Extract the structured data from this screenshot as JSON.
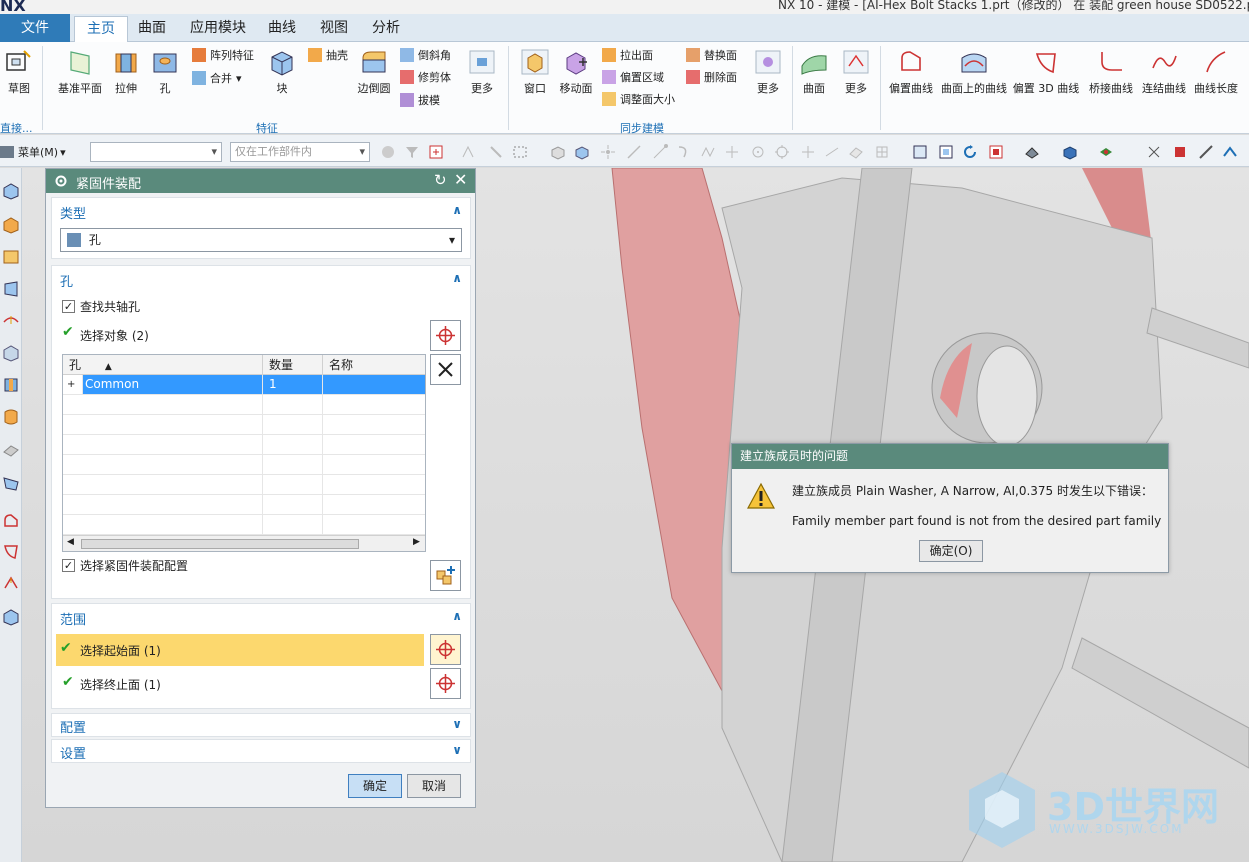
{
  "titlebar": {
    "logo": "NX",
    "title": "NX 10 - 建模 - [AI-Hex Bolt Stacks 1.prt（修改的） 在 装配 green house SD0522.p"
  },
  "tabs": [
    "文件(F)",
    "主页",
    "曲面",
    "应用模块",
    "曲线",
    "视图",
    "分析"
  ],
  "ribbon": {
    "sketch": "草图",
    "datum_plane": "基准平面",
    "extrude": "拉伸",
    "hole": "孔",
    "pattern_feature": "阵列特征",
    "unite": "合并",
    "block": "块",
    "shell": "抽壳",
    "edge_blend": "边倒圆",
    "chamfer": "倒斜角",
    "trim_body": "修剪体",
    "draft": "拔模",
    "more1": "更多",
    "window": "窗口",
    "move_face": "移动面",
    "pull_face": "拉出面",
    "offset_region": "偏置区域",
    "resize_face": "调整面大小",
    "replace_face": "替换面",
    "delete_face": "删除面",
    "more2": "更多",
    "surface": "曲面",
    "more3": "更多",
    "offset_curve": "偏置曲线",
    "curve_on_face": "曲面上的曲线",
    "offset_3d": "偏置 3D 曲线",
    "bridge_curve": "桥接曲线",
    "join_curve": "连结曲线",
    "curve_length": "曲线长度",
    "group_feature": "特征",
    "group_sync": "同步建模",
    "group_direct": "直接..."
  },
  "toolbar": {
    "menu": "菜单(M)",
    "filter_placeholder": "",
    "scope": "仅在工作部件内"
  },
  "panel": {
    "title": "紧固件装配",
    "type_section": "类型",
    "type_value": "孔",
    "hole_section": "孔",
    "find_coaxial": "查找共轴孔",
    "select_objects": "选择对象 (2)",
    "table": {
      "headers": [
        "孔",
        "数量",
        "名称"
      ],
      "rows": [
        {
          "hole": "Common",
          "qty": "1",
          "name": ""
        }
      ]
    },
    "select_config": "选择紧固件装配配置",
    "range_section": "范围",
    "start_face": "选择起始面 (1)",
    "end_face": "选择终止面 (1)",
    "config_section": "配置",
    "settings_section": "设置",
    "ok": "确定",
    "cancel": "取消"
  },
  "dialog": {
    "title": "建立族成员时的问题",
    "line1": "建立族成员 Plain Washer, A Narrow, AI,0.375 时发生以下错误：",
    "line2": "Family member part found is not from the desired part family",
    "ok": "确定(O)"
  },
  "watermark": {
    "brand": "3D世界网",
    "url": "WWW.3DSJW.COM"
  },
  "colors": {
    "accent": "#1d6fb5",
    "panel_header": "#5a8a7c",
    "highlight_row": "#fcd86e",
    "selection": "#3399ff",
    "red_part": "#e58f8f"
  }
}
